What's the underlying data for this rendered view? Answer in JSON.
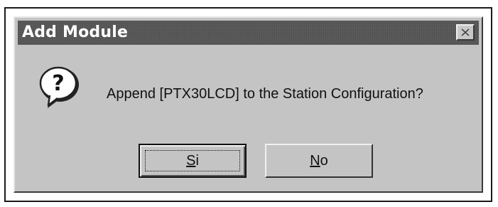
{
  "dialog": {
    "title": "Add Module",
    "close_icon": "close-icon",
    "message_icon": "question-icon",
    "message": "Append [PTX30LCD] to the Station Configuration?"
  },
  "buttons": {
    "yes": {
      "mnemonic": "S",
      "rest": "i"
    },
    "no": {
      "mnemonic": "N",
      "rest": "o"
    }
  }
}
